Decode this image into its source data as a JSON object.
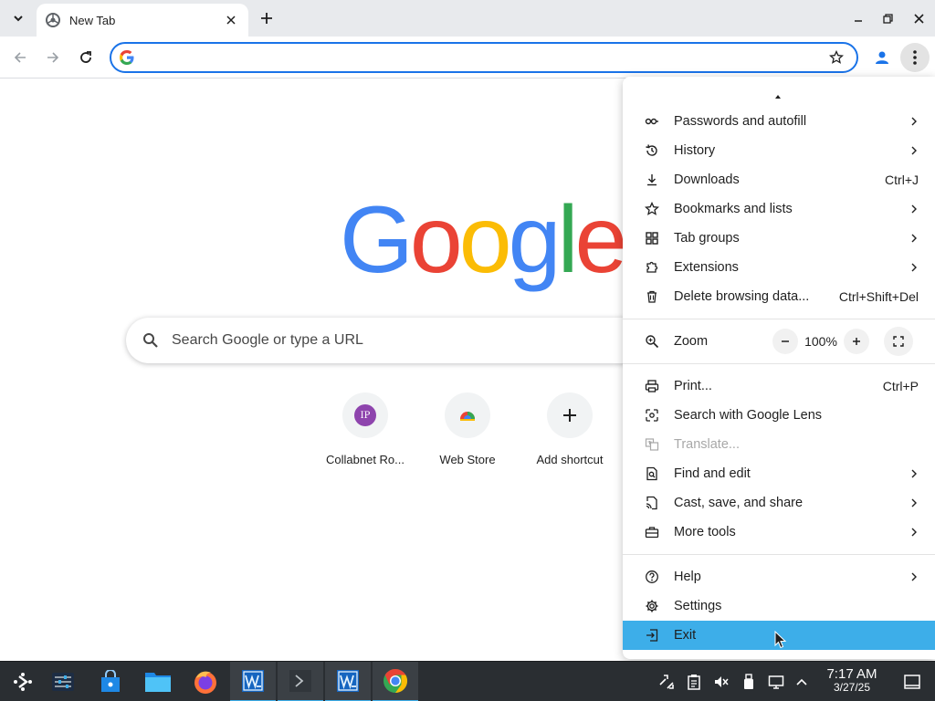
{
  "browser": {
    "tab_title": "New Tab",
    "omnibox_value": "",
    "omnibox_placeholder": ""
  },
  "ntp": {
    "logo_letters": [
      "G",
      "o",
      "o",
      "g",
      "l",
      "e"
    ],
    "search_placeholder": "Search Google or type a URL",
    "shortcuts": [
      {
        "name": "Collabnet Ro...",
        "icon_text": "IP"
      },
      {
        "name": "Web Store",
        "icon_text": ""
      },
      {
        "name": "Add shortcut",
        "icon_text": ""
      }
    ]
  },
  "menu": {
    "items": [
      {
        "label": "Passwords and autofill",
        "icon": "key-icon",
        "arrow": true
      },
      {
        "label": "History",
        "icon": "history-icon",
        "arrow": true
      },
      {
        "label": "Downloads",
        "icon": "download-icon",
        "shortcut": "Ctrl+J"
      },
      {
        "label": "Bookmarks and lists",
        "icon": "star-icon",
        "arrow": true
      },
      {
        "label": "Tab groups",
        "icon": "grid-icon",
        "arrow": true
      },
      {
        "label": "Extensions",
        "icon": "puzzle-icon",
        "arrow": true
      },
      {
        "label": "Delete browsing data...",
        "icon": "trash-icon",
        "shortcut": "Ctrl+Shift+Del"
      },
      {
        "label": "Zoom",
        "icon": "zoom-icon",
        "zoom_value": "100%"
      },
      {
        "label": "Print...",
        "icon": "print-icon",
        "shortcut": "Ctrl+P"
      },
      {
        "label": "Search with Google Lens",
        "icon": "lens-icon"
      },
      {
        "label": "Translate...",
        "icon": "translate-icon",
        "disabled": true
      },
      {
        "label": "Find and edit",
        "icon": "find-icon",
        "arrow": true
      },
      {
        "label": "Cast, save, and share",
        "icon": "cast-icon",
        "arrow": true
      },
      {
        "label": "More tools",
        "icon": "toolbox-icon",
        "arrow": true
      },
      {
        "label": "Help",
        "icon": "help-icon",
        "arrow": true
      },
      {
        "label": "Settings",
        "icon": "gear-icon"
      },
      {
        "label": "Exit",
        "icon": "exit-icon",
        "highlighted": true
      }
    ]
  },
  "taskbar": {
    "clock_time": "7:17 AM",
    "clock_date": "3/27/25"
  },
  "colors": {
    "accent": "#1a73e8",
    "menu_highlight": "#3daee9",
    "taskbar_bg": "#2a2e32"
  }
}
